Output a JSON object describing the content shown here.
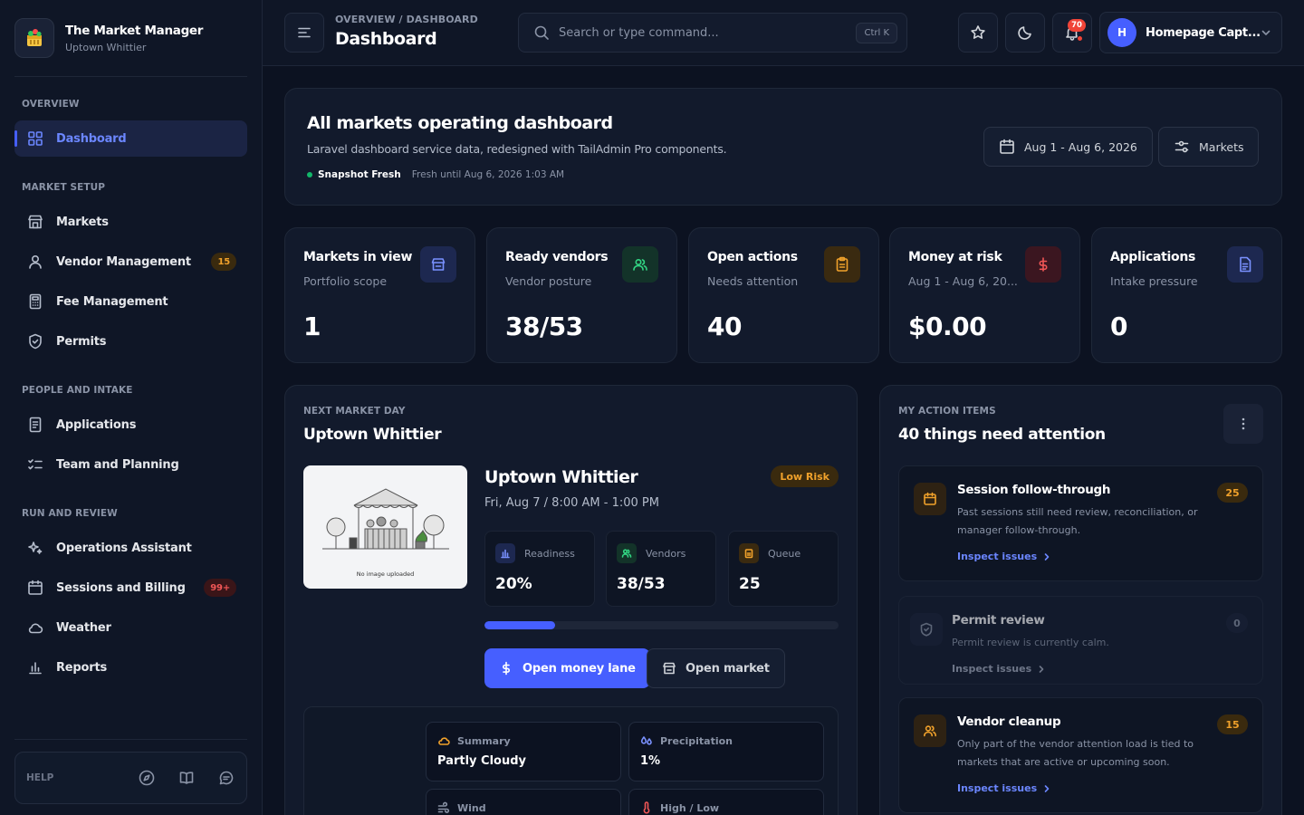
{
  "brand": {
    "name": "The Market Manager",
    "sub": "Uptown Whittier"
  },
  "sidebar": {
    "sections": [
      {
        "label": "OVERVIEW"
      },
      {
        "label": "MARKET SETUP"
      },
      {
        "label": "PEOPLE AND INTAKE"
      },
      {
        "label": "RUN AND REVIEW"
      }
    ],
    "items": [
      {
        "label": "Dashboard",
        "icon": "grid-icon",
        "active": true
      },
      {
        "label": "Markets",
        "icon": "store-icon"
      },
      {
        "label": "Vendor Management",
        "icon": "user-icon",
        "badge": "15"
      },
      {
        "label": "Fee Management",
        "icon": "calculator-icon"
      },
      {
        "label": "Permits",
        "icon": "shield-icon"
      },
      {
        "label": "Applications",
        "icon": "document-icon"
      },
      {
        "label": "Team and Planning",
        "icon": "checklist-icon"
      },
      {
        "label": "Operations Assistant",
        "icon": "sparkles-icon"
      },
      {
        "label": "Sessions and Billing",
        "icon": "calendar-icon",
        "badge": "99+"
      },
      {
        "label": "Weather",
        "icon": "cloud-icon"
      },
      {
        "label": "Reports",
        "icon": "bar-chart-icon"
      }
    ],
    "help": {
      "label": "HELP"
    }
  },
  "header": {
    "breadcrumb": "OVERVIEW / DASHBOARD",
    "title": "Dashboard",
    "search": {
      "placeholder": "Search or type command...",
      "shortcut": "Ctrl K"
    },
    "notifications_count": "70",
    "user": {
      "initial": "H",
      "name": "Homepage Capt..."
    }
  },
  "hero": {
    "title": "All markets operating dashboard",
    "description": "Laravel dashboard service data, redesigned with TailAdmin Pro components.",
    "status_label": "Snapshot Fresh",
    "status_detail": "Fresh until Aug 6, 2026 1:03 AM",
    "date_range": "Aug 1 - Aug 6, 2026",
    "markets_button": "Markets"
  },
  "stats": [
    {
      "title": "Markets in view",
      "sub": "Portfolio scope",
      "value": "1",
      "icon": "store-icon",
      "color": "#7a91ff"
    },
    {
      "title": "Ready vendors",
      "sub": "Vendor posture",
      "value": "38/53",
      "icon": "users-icon",
      "color": "#32d583"
    },
    {
      "title": "Open actions",
      "sub": "Needs attention",
      "value": "40",
      "icon": "clipboard-icon",
      "color": "#f0a12b"
    },
    {
      "title": "Money at risk",
      "sub": "Aug 1 - Aug 6, 20...",
      "value": "$0.00",
      "icon": "dollar-icon",
      "color": "#f05656"
    },
    {
      "title": "Applications",
      "sub": "Intake pressure",
      "value": "0",
      "icon": "document-icon",
      "color": "#7a91ff"
    }
  ],
  "next_market": {
    "label": "NEXT MARKET DAY",
    "title": "Uptown Whittier",
    "image_caption": "No image uploaded",
    "name": "Uptown Whittier",
    "date": "Fri, Aug 7 / 8:00 AM - 1:00 PM",
    "risk": "Low Risk",
    "metrics": [
      {
        "label": "Readiness",
        "value": "20%"
      },
      {
        "label": "Vendors",
        "value": "38/53"
      },
      {
        "label": "Queue",
        "value": "25"
      }
    ],
    "readiness_fraction": 0.2,
    "primary_button": "Open money lane",
    "secondary_button": "Open market",
    "weather": [
      {
        "label": "Summary",
        "value": "Partly Cloudy"
      },
      {
        "label": "Precipitation",
        "value": "1%"
      },
      {
        "label": "Wind",
        "value": ""
      },
      {
        "label": "High / Low",
        "value": ""
      }
    ]
  },
  "action_items": {
    "label": "MY ACTION ITEMS",
    "title": "40 things need attention",
    "items": [
      {
        "title": "Session follow-through",
        "description": "Past sessions still need review, reconciliation, or manager follow-through.",
        "link": "Inspect issues",
        "count": "25"
      },
      {
        "title": "Permit review",
        "description": "Permit review is currently calm.",
        "link": "Inspect issues",
        "count": "0"
      },
      {
        "title": "Vendor cleanup",
        "description": "Only part of the vendor attention load is tied to markets that are active or upcoming soon.",
        "link": "Inspect issues",
        "count": "15"
      }
    ]
  }
}
